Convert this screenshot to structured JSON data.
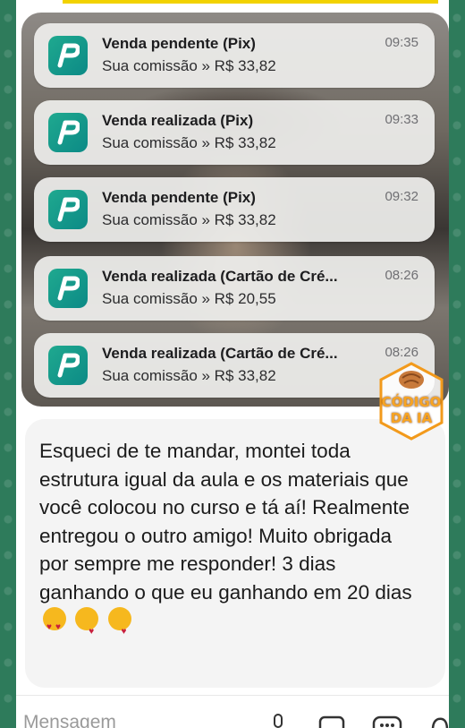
{
  "notifications": [
    {
      "title": "Venda pendente (Pix)",
      "body": "Sua comissão » R$ 33,82",
      "time": "09:35"
    },
    {
      "title": "Venda realizada (Pix)",
      "body": "Sua comissão » R$ 33,82",
      "time": "09:33"
    },
    {
      "title": "Venda pendente (Pix)",
      "body": "Sua comissão » R$ 33,82",
      "time": "09:32"
    },
    {
      "title": "Venda realizada (Cartão de Cré...",
      "body": "Sua comissão » R$ 20,55",
      "time": "08:26"
    },
    {
      "title": "Venda realizada (Cartão de Cré...",
      "body": "Sua comissão » R$ 33,82",
      "time": "08:26"
    }
  ],
  "watermark": {
    "line1": "CÓDIGO",
    "line2": "DA IA"
  },
  "message": {
    "text": "Esqueci de te mandar, montei toda estrutura igual da aula e os materiais que você colocou no curso e tá aí! Realmente entregou o outro amigo! Muito obrigada por sempre me responder! 3 dias ganhando o que eu ganhando em 20 dias",
    "emojis": [
      "heart-eyes-emoji",
      "kissing-heart-emoji",
      "kissing-heart-emoji"
    ]
  },
  "input": {
    "placeholder": "Mensagem"
  },
  "colors": {
    "accent": "#f2d200",
    "app_icon": "#129c8c",
    "chat_bg": "#2f7a5c"
  }
}
